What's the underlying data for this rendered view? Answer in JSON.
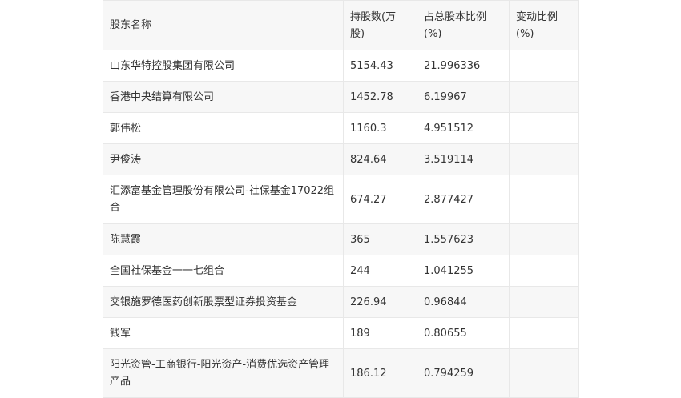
{
  "table": {
    "headers": [
      "股东名称",
      "持股数(万股)",
      "占总股本比例(%)",
      "变动比例(%)"
    ],
    "rows": [
      [
        "山东华特控股集团有限公司",
        "5154.43",
        "21.996336",
        ""
      ],
      [
        "香港中央结算有限公司",
        "1452.78",
        "6.19967",
        ""
      ],
      [
        "郭伟松",
        "1160.3",
        "4.951512",
        ""
      ],
      [
        "尹俊涛",
        "824.64",
        "3.519114",
        ""
      ],
      [
        "汇添富基金管理股份有限公司-社保基金17022组合",
        "674.27",
        "2.877427",
        ""
      ],
      [
        "陈慧霞",
        "365",
        "1.557623",
        ""
      ],
      [
        "全国社保基金一一七组合",
        "244",
        "1.041255",
        ""
      ],
      [
        "交银施罗德医药创新股票型证券投资基金",
        "226.94",
        "0.96844",
        ""
      ],
      [
        "钱军",
        "189",
        "0.80655",
        ""
      ],
      [
        "阳光资管-工商银行-阳光资产-消费优选资产管理产品",
        "186.12",
        "0.794259",
        ""
      ]
    ]
  }
}
